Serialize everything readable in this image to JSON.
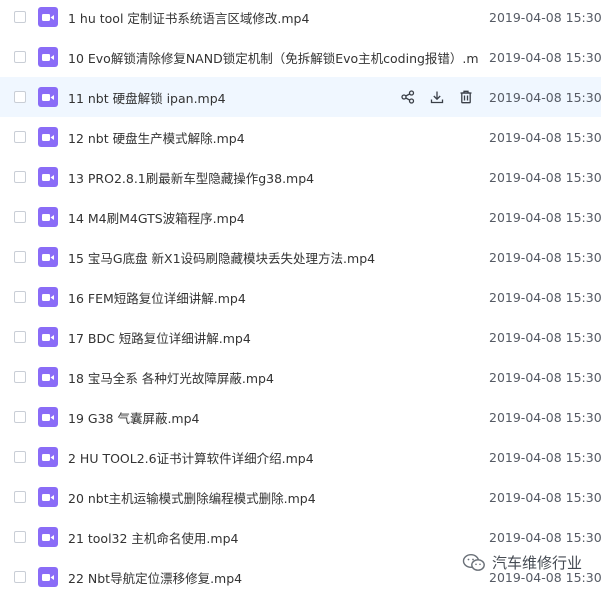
{
  "files": [
    {
      "name": "1 hu tool  定制证书系统语言区域修改.mp4",
      "date": "2019-04-08 15:30"
    },
    {
      "name": "10 Evo解锁清除修复NAND锁定机制（免拆解锁Evo主机coding报错）.m...",
      "date": "2019-04-08 15:30"
    },
    {
      "name": "11  nbt 硬盘解锁 ipan.mp4",
      "date": "2019-04-08 15:30"
    },
    {
      "name": "12 nbt 硬盘生产模式解除.mp4",
      "date": "2019-04-08 15:30"
    },
    {
      "name": "13 PRO2.8.1刷最新车型隐藏操作g38.mp4",
      "date": "2019-04-08 15:30"
    },
    {
      "name": "14 M4刷M4GTS波箱程序.mp4",
      "date": "2019-04-08 15:30"
    },
    {
      "name": "15 宝马G底盘 新X1设码刷隐藏模块丢失处理方法.mp4",
      "date": "2019-04-08 15:30"
    },
    {
      "name": "16  FEM短路复位详细讲解.mp4",
      "date": "2019-04-08 15:30"
    },
    {
      "name": "17 BDC 短路复位详细讲解.mp4",
      "date": "2019-04-08 15:30"
    },
    {
      "name": "18  宝马全系 各种灯光故障屏蔽.mp4",
      "date": "2019-04-08 15:30"
    },
    {
      "name": "19 G38 气囊屏蔽.mp4",
      "date": "2019-04-08 15:30"
    },
    {
      "name": "2 HU TOOL2.6证书计算软件详细介绍.mp4",
      "date": "2019-04-08 15:30"
    },
    {
      "name": "20  nbt主机运输模式删除编程模式删除.mp4",
      "date": "2019-04-08 15:30"
    },
    {
      "name": "21 tool32 主机命名使用.mp4",
      "date": "2019-04-08 15:30"
    },
    {
      "name": "22 Nbt导航定位漂移修复.mp4",
      "date": "2019-04-08 15:30"
    }
  ],
  "hover_row": 2,
  "icons": {
    "file": "video-file-icon",
    "share": "share-icon",
    "download": "download-icon",
    "delete": "trash-icon"
  },
  "colors": {
    "file_icon": "#8a6cf7",
    "hover_bg": "#f0f7ff",
    "action_icon": "#3a3f47"
  },
  "watermark": {
    "text": "汽车维修行业"
  }
}
